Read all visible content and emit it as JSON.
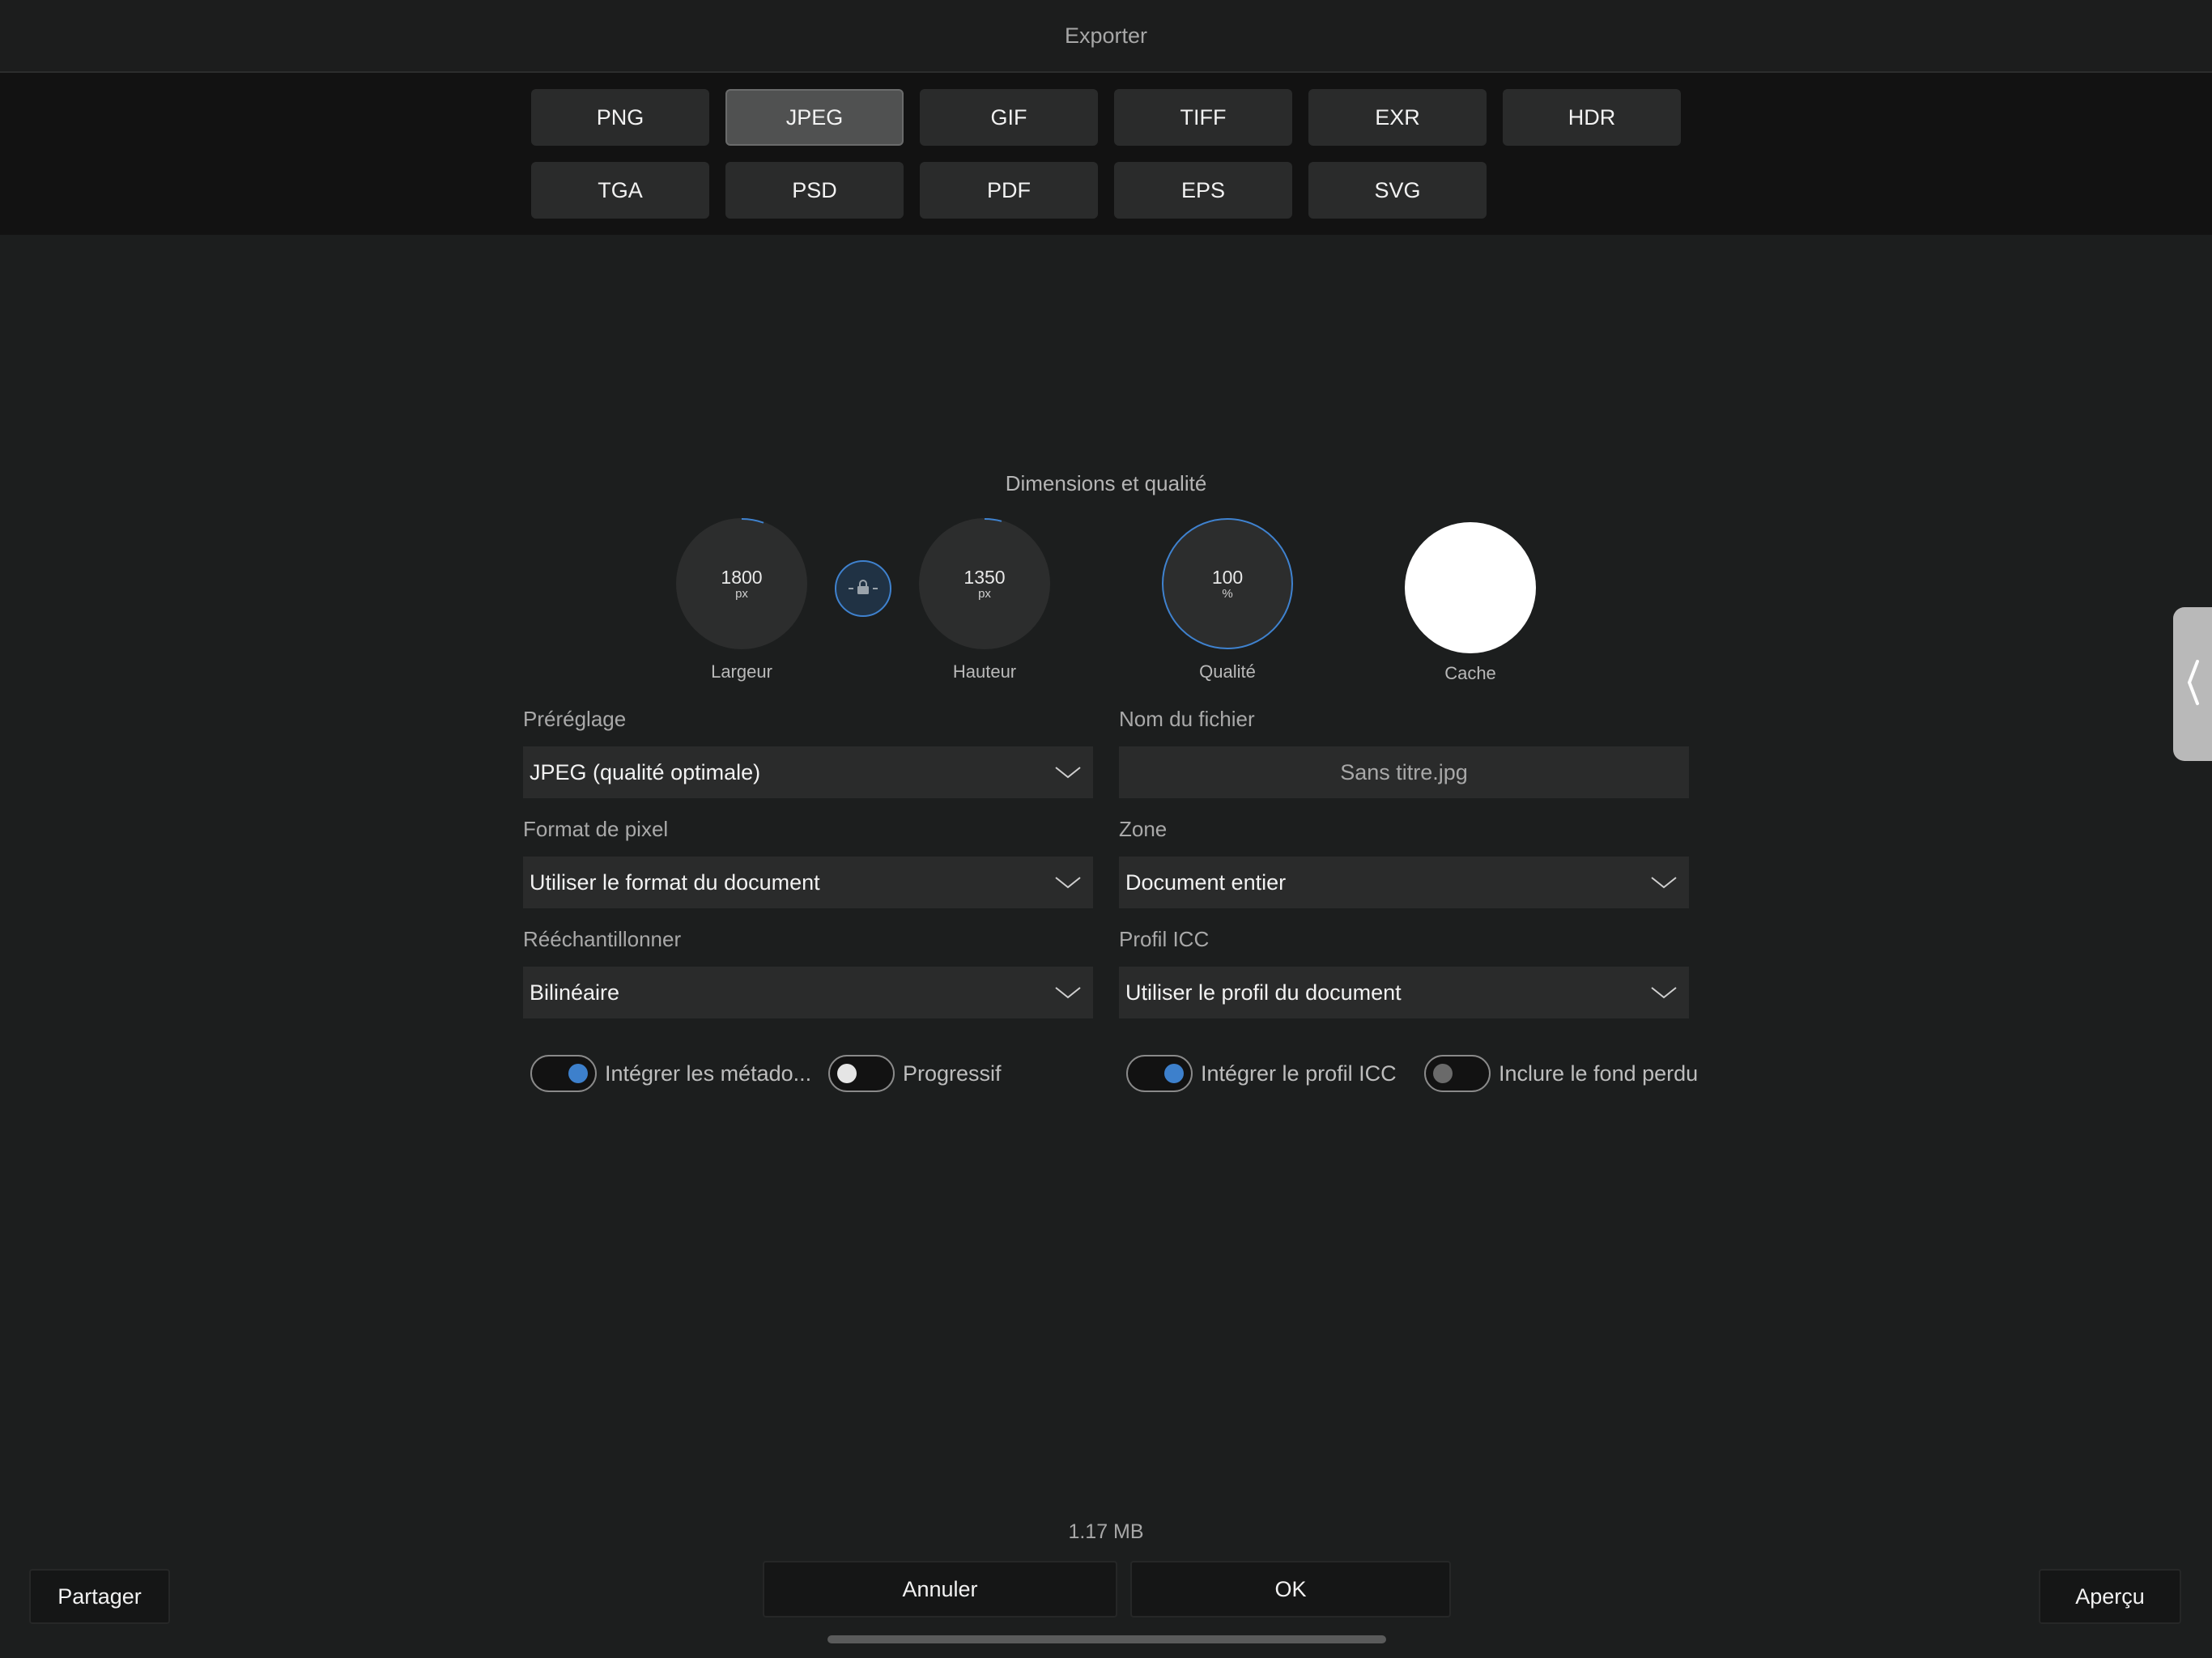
{
  "title": "Exporter",
  "formats": [
    "PNG",
    "JPEG",
    "GIF",
    "TIFF",
    "EXR",
    "HDR",
    "TGA",
    "PSD",
    "PDF",
    "EPS",
    "SVG"
  ],
  "selected_format": "JPEG",
  "section_title": "Dimensions et qualité",
  "dials": {
    "width": {
      "value": "1800",
      "unit": "px",
      "label": "Largeur"
    },
    "height": {
      "value": "1350",
      "unit": "px",
      "label": "Hauteur"
    },
    "quality": {
      "value": "100",
      "unit": "%",
      "label": "Qualité"
    },
    "mask": {
      "label": "Cache"
    }
  },
  "fields": {
    "preset": {
      "label": "Préréglage",
      "value": "JPEG (qualité optimale)"
    },
    "filename": {
      "label": "Nom du fichier",
      "value": "Sans titre.jpg"
    },
    "pixel_format": {
      "label": "Format de pixel",
      "value": "Utiliser le format du document"
    },
    "area": {
      "label": "Zone",
      "value": "Document entier"
    },
    "resample": {
      "label": "Rééchantillonner",
      "value": "Bilinéaire"
    },
    "icc_profile": {
      "label": "Profil ICC",
      "value": "Utiliser le profil du document"
    }
  },
  "toggles": {
    "metadata": {
      "label": "Intégrer les métado...",
      "on": true
    },
    "progressive": {
      "label": "Progressif",
      "on": false
    },
    "embed_icc": {
      "label": "Intégrer le profil ICC",
      "on": true
    },
    "bleed": {
      "label": "Inclure le fond perdu",
      "on": false
    }
  },
  "file_size": "1.17 MB",
  "buttons": {
    "share": "Partager",
    "cancel": "Annuler",
    "ok": "OK",
    "preview": "Aperçu"
  },
  "colors": {
    "accent": "#3f82cf",
    "background": "#1c1e1e",
    "control": "#2a2b2b"
  }
}
